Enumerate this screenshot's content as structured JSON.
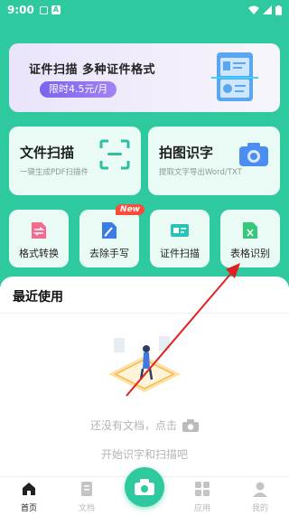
{
  "status_bar": {
    "time": "9:00",
    "app_badge": "A"
  },
  "banner": {
    "title": "证件扫描  多种证件格式",
    "price": "限时4.5元/月"
  },
  "big_cards": [
    {
      "title": "文件扫描",
      "subtitle": "一键生成PDF扫描件",
      "icon": "scan-frame-icon"
    },
    {
      "title": "拍图识字",
      "subtitle": "提取文字导出Word/TXT",
      "icon": "camera-icon"
    }
  ],
  "small_cards": [
    {
      "label": "格式转换",
      "icon": "convert-icon",
      "color": "#f46b8e"
    },
    {
      "label": "去除手写",
      "icon": "erase-handwriting-icon",
      "color": "#3b7be8",
      "badge": "New"
    },
    {
      "label": "证件扫描",
      "icon": "id-card-icon",
      "color": "#27c3b6"
    },
    {
      "label": "表格识别",
      "icon": "excel-icon",
      "color": "#34c87a"
    }
  ],
  "recent": {
    "title": "最近使用",
    "empty_line1": "还没有文档，点击",
    "empty_line2": "开始识字和扫描吧"
  },
  "nav": {
    "home": "首页",
    "docs": "文档",
    "apps": "应用",
    "mine": "我的"
  },
  "colors": {
    "brand": "#2fc9a0",
    "accent": "#7c63ee",
    "annotation": "#e02020"
  }
}
